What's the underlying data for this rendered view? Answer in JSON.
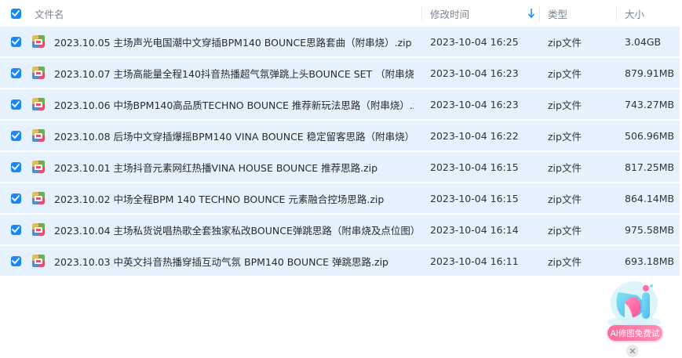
{
  "header": {
    "name_label": "文件名",
    "time_label": "修改时间",
    "type_label": "类型",
    "size_label": "大小",
    "select_all_checked": true
  },
  "files": [
    {
      "name": "2023.10.05 主场声光电国潮中文穿插BPM140 BOUNCE思路套曲（附串烧）.zip",
      "time": "2023-10-04 16:25",
      "type": "zip文件",
      "size": "3.04GB",
      "checked": true
    },
    {
      "name": "2023.10.07 主场高能量全程140抖音热播超气氛弹跳上头BOUNCE SET （附串烧及...",
      "time": "2023-10-04 16:23",
      "type": "zip文件",
      "size": "879.91MB",
      "checked": true
    },
    {
      "name": "2023.10.06 中场BPM140高品质TECHNO BOUNCE 推荐新玩法思路（附串烧）.zip",
      "time": "2023-10-04 16:23",
      "type": "zip文件",
      "size": "743.27MB",
      "checked": true
    },
    {
      "name": "2023.10.08 后场中文穿插爆摇BPM140 VINA BOUNCE 稳定留客思路（附串烧）.zip",
      "time": "2023-10-04 16:22",
      "type": "zip文件",
      "size": "506.96MB",
      "checked": true
    },
    {
      "name": "2023.10.01 主场抖音元素网红热播VINA HOUSE  BOUNCE 推荐思路.zip",
      "time": "2023-10-04 16:15",
      "type": "zip文件",
      "size": "817.25MB",
      "checked": true
    },
    {
      "name": "2023.10.02 中场全程BPM 140  TECHNO  BOUNCE 元素融合控场思路.zip",
      "time": "2023-10-04 16:15",
      "type": "zip文件",
      "size": "864.14MB",
      "checked": true
    },
    {
      "name": "2023.10.04 主场私货说唱热歌全套独家私改BOUNCE弹跳思路（附串烧及点位图）.z...",
      "time": "2023-10-04 16:14",
      "type": "zip文件",
      "size": "975.58MB",
      "checked": true
    },
    {
      "name": "2023.10.03 中英文抖音热播穿插互动气氛 BPM140  BOUNCE 弹跳思路.zip",
      "time": "2023-10-04 16:11",
      "type": "zip文件",
      "size": "693.18MB",
      "checked": true
    }
  ],
  "icons": {
    "checkbox": "checkbox-checked-icon",
    "sort": "sort-desc-arrow-icon",
    "file": "zip-archive-icon",
    "ai": "ai-assistant-icon",
    "close": "close-icon"
  },
  "ai_widget": {
    "label": "AI修图免费试"
  },
  "colors": {
    "accent": "#1a88f2",
    "row_selected_bg": "#e5f1fc",
    "header_text": "#7a8594",
    "ai_pink": "#ff6b9e"
  }
}
